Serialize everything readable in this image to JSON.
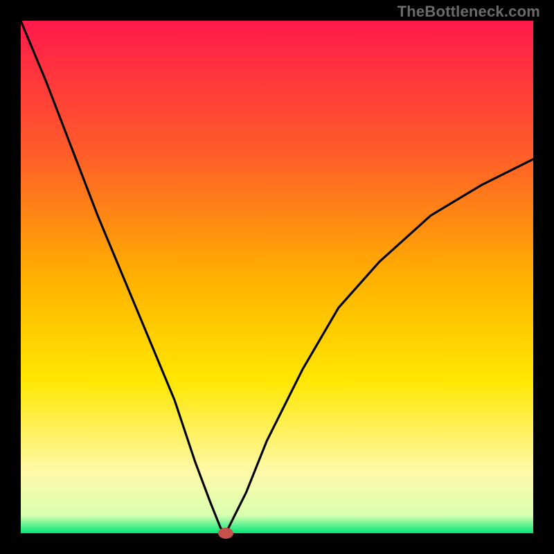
{
  "watermark": "TheBottleneck.com",
  "chart_data": {
    "type": "line",
    "title": "",
    "xlabel": "",
    "ylabel": "",
    "xlim": [
      0,
      100
    ],
    "ylim": [
      0,
      100
    ],
    "grid": false,
    "legend": false,
    "background_gradient": {
      "stops": [
        {
          "pos": 0.0,
          "color": "#ff1a4b"
        },
        {
          "pos": 0.25,
          "color": "#ff5a2a"
        },
        {
          "pos": 0.5,
          "color": "#ffb000"
        },
        {
          "pos": 0.7,
          "color": "#ffe600"
        },
        {
          "pos": 0.88,
          "color": "#fff9a8"
        },
        {
          "pos": 0.965,
          "color": "#d8ffb0"
        },
        {
          "pos": 1.0,
          "color": "#00e676"
        }
      ]
    },
    "marker": {
      "x": 40,
      "y": 0,
      "color": "#c6504b"
    },
    "series": [
      {
        "name": "bottleneck-curve",
        "x": [
          0,
          5,
          10,
          15,
          20,
          25,
          30,
          34,
          37,
          39,
          40,
          41,
          44,
          48,
          55,
          62,
          70,
          80,
          90,
          100
        ],
        "values": [
          100,
          88,
          75,
          62,
          50,
          38,
          26,
          14,
          6,
          1,
          0,
          2,
          8,
          18,
          32,
          44,
          53,
          62,
          68,
          73
        ]
      }
    ]
  }
}
